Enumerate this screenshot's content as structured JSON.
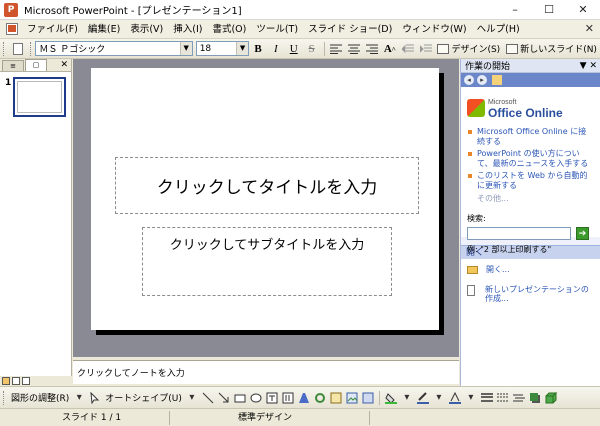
{
  "window": {
    "title": "Microsoft PowerPoint - [プレゼンテーション1]",
    "app_icon": "P",
    "buttons": [
      "–",
      "☐",
      "✕"
    ]
  },
  "menubar": {
    "items": [
      "ファイル(F)",
      "編集(E)",
      "表示(V)",
      "挿入(I)",
      "書式(O)",
      "ツール(T)",
      "スライド ショー(D)",
      "ウィンドウ(W)",
      "ヘルプ(H)"
    ],
    "close": "✕"
  },
  "toolbar": {
    "font_name": "ＭＳ Ｐゴシック",
    "font_size": "18",
    "bold": "B",
    "italic": "I",
    "underline": "U",
    "strike": "S",
    "design_label": "デザイン(S)",
    "new_slide_label": "新しいスライド(N)"
  },
  "left_panel": {
    "tab_outline": "≡",
    "tab_slides": "▢",
    "close": "✕",
    "slide_number": "1"
  },
  "slide": {
    "title_placeholder": "クリックしてタイトルを入力",
    "subtitle_placeholder": "クリックしてサブタイトルを入力"
  },
  "notes": {
    "placeholder": "クリックしてノートを入力"
  },
  "task_pane": {
    "title": "作業の開始",
    "header_tools": "▼ ✕",
    "nav_back": "◂",
    "nav_forward": "▸",
    "logo_small": "Microsoft",
    "logo_big": "Office Online",
    "links": [
      "Microsoft Office Online に接続する",
      "PowerPoint の使い方について、最新のニュースを入手する",
      "このリストを Web から自動的に更新する"
    ],
    "more": "その他...",
    "search_label": "検索:",
    "search_value": "",
    "search_go": "➔",
    "search_example": "例: \"2 部以上印刷する\"",
    "open_section": "開く",
    "open_items": [
      "開く...",
      "新しいプレゼンテーションの作成..."
    ]
  },
  "drawing_toolbar": {
    "draw_label": "図形の調整(R)",
    "autoshape_label": "オートシェイプ(U)"
  },
  "statusbar": {
    "slide_info": "スライド 1 / 1",
    "design": "標準デザイン"
  },
  "colors": {
    "slide_area_bg": "#8a8a94",
    "task_pane_nav": "#6b86c9",
    "link": "#2b56b5",
    "bullet": "#e8862a"
  }
}
